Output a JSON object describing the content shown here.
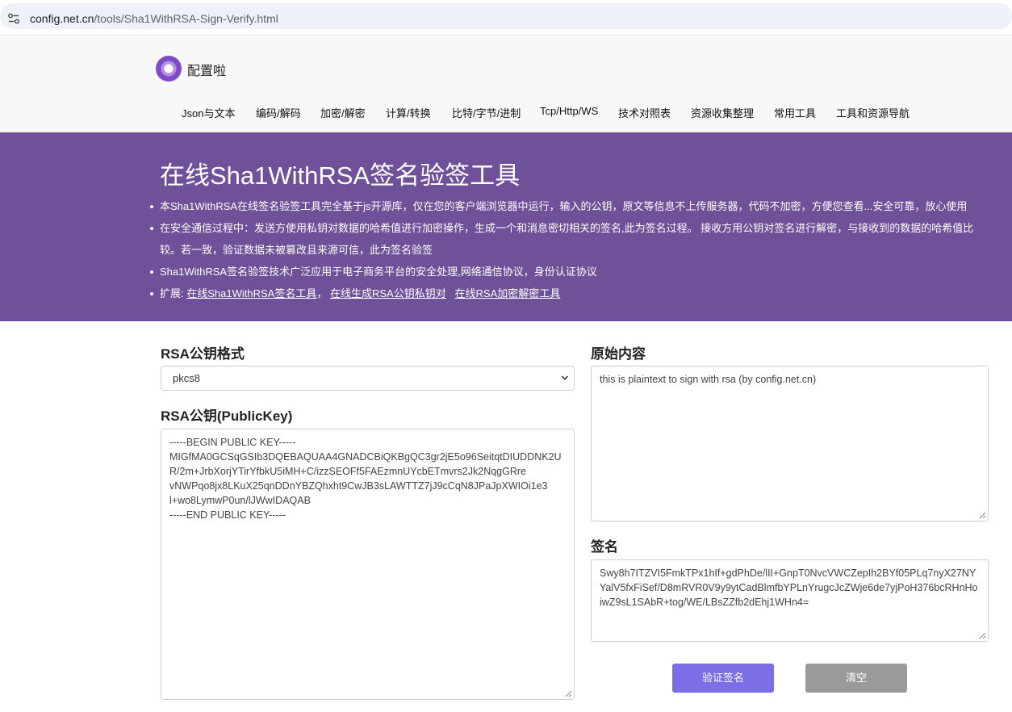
{
  "browser": {
    "url_host": "config.net.cn",
    "url_path": "/tools/Sha1WithRSA-Sign-Verify.html"
  },
  "site": {
    "name": "配置啦",
    "nav": [
      "Json与文本",
      "编码/解码",
      "加密/解密",
      "计算/转换",
      "比特/字节/进制",
      "Tcp/Http/WS",
      "技术对照表",
      "资源收集整理",
      "常用工具",
      "工具和资源导航"
    ]
  },
  "hero": {
    "title": "在线Sha1WithRSA签名验签工具",
    "items": [
      "本Sha1WithRSA在线签名验签工具完全基于js开源库，仅在您的客户端浏览器中运行，输入的公钥，原文等信息不上传服务器，代码不加密，方便您查看...安全可靠，放心使用",
      "在安全通信过程中：发送方使用私钥对数据的哈希值进行加密操作，生成一个和消息密切相关的签名,此为签名过程。 接收方用公钥对签名进行解密，与接收到的数据的哈希值比较。若一致，验证数据未被篡改且来源可信，此为签名验签",
      "Sha1WithRSA签名验签技术广泛应用于电子商务平台的安全处理,网络通信协议，身份认证协议"
    ],
    "ext_prefix": "扩展: ",
    "ext_links": [
      "在线Sha1WithRSA签名工具",
      "在线生成RSA公钥私钥对",
      "在线RSA加密解密工具"
    ],
    "ext_sep": "，"
  },
  "form": {
    "format_label": "RSA公钥格式",
    "format_value": "pkcs8",
    "pubkey_label": "RSA公钥(PublicKey)",
    "pubkey_value": "-----BEGIN PUBLIC KEY-----\nMIGfMA0GCSqGSIb3DQEBAQUAA4GNADCBiQKBgQC3gr2jE5o96SeitqtDIUDDNK2U\nR/2m+JrbXorjYTirYfbkU5iMH+C/izzSEOFf5FAEzmnUYcbETmvrs2Jk2NqgGRre\nvNWPqo8jx8LKuX25qnDDnYBZQhxht9CwJB3sLAWTTZ7jJ9cCqN8JPaJpXWIOi1e3\nl+wo8LymwP0un/lJWwIDAQAB\n-----END PUBLIC KEY-----",
    "plaintext_label": "原始内容",
    "plaintext_value": "this is plaintext to sign with rsa (by config.net.cn)",
    "signature_label": "签名",
    "signature_value": "Swy8h7ITZVI5FmkTPx1hIf+gdPhDe/lII+GnpT0NvcVWCZepIh2BYf05PLq7nyX27NYYalV5fxFiSef/D8mRVR0V9y9ytCadBlmfbYPLnYrugcJcZWje6de7yjPoH376bcRHnHoiwZ9sL1SAbR+tog/WE/LBsZZfb2dEhj1WHn4=",
    "verify_button": "验证签名",
    "clear_button": "清空"
  }
}
